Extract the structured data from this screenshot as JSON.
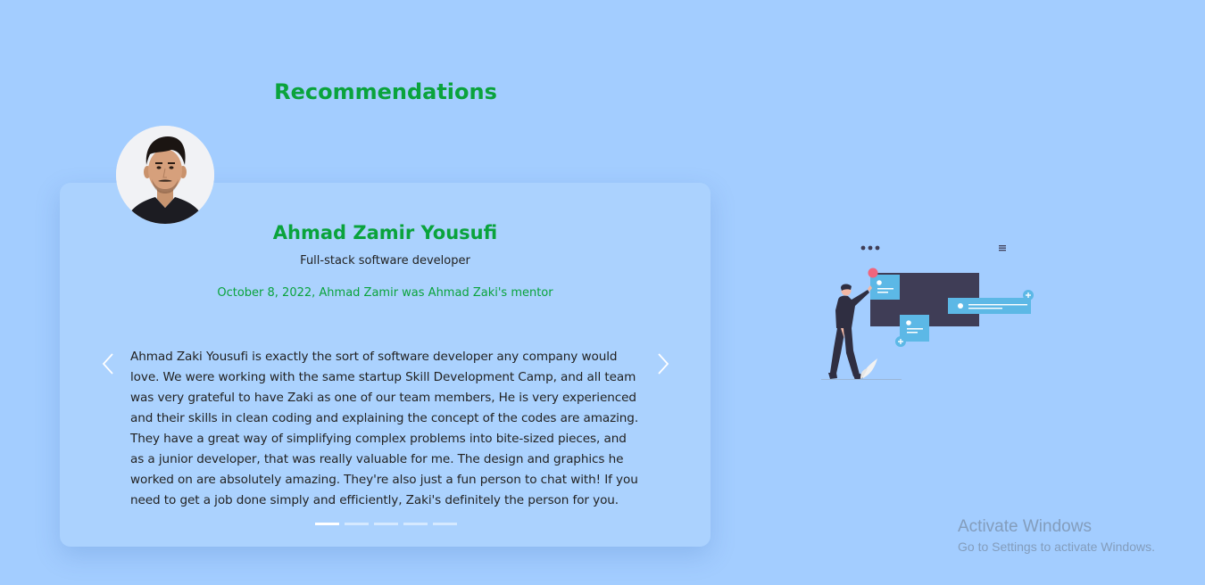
{
  "section": {
    "title": "Recommendations"
  },
  "recommendation": {
    "name": "Ahmad Zamir Yousufi",
    "role": "Full-stack software developer",
    "relation": "October 8, 2022, Ahmad Zamir was Ahmad Zaki's mentor",
    "text": "Ahmad Zaki Yousufi is exactly the sort of software developer any company would love. We were working with the same startup Skill Development Camp, and all team was very grateful to have Zaki as one of our team members, He is very experienced and their skills in clean coding and explaining the concept of the codes are amazing. They have a great way of simplifying complex problems into bite-sized pieces, and as a junior developer, that was really valuable for me. The design and graphics he worked on are absolutely amazing. They're also just a fun person to chat with! If you need to get a job done simply and efficiently, Zaki's definitely the person for you."
  },
  "carousel": {
    "slide_count": 5,
    "active_index": 0,
    "prev_icon": "chevron-left-icon",
    "next_icon": "chevron-right-icon"
  },
  "watermark": {
    "title": "Activate Windows",
    "subtitle": "Go to Settings to activate Windows."
  },
  "colors": {
    "background": "#a3cdff",
    "card": "#abd2fe",
    "accent_green": "#0aa33c"
  }
}
